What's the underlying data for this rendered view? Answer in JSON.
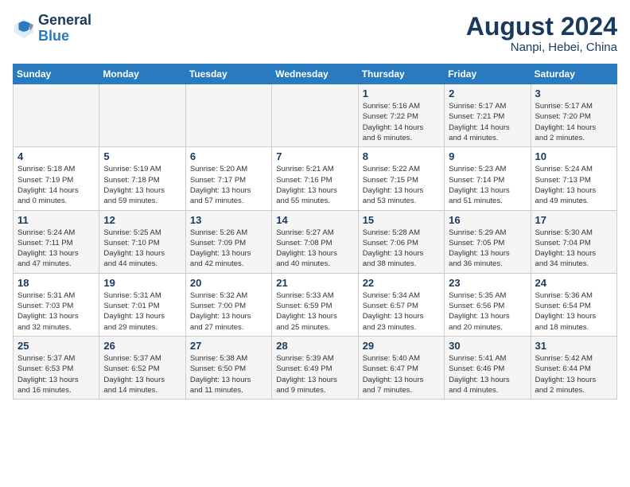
{
  "header": {
    "logo_line1": "General",
    "logo_line2": "Blue",
    "month_title": "August 2024",
    "subtitle": "Nanpi, Hebei, China"
  },
  "calendar": {
    "days_of_week": [
      "Sunday",
      "Monday",
      "Tuesday",
      "Wednesday",
      "Thursday",
      "Friday",
      "Saturday"
    ],
    "weeks": [
      [
        {
          "day": "",
          "info": ""
        },
        {
          "day": "",
          "info": ""
        },
        {
          "day": "",
          "info": ""
        },
        {
          "day": "",
          "info": ""
        },
        {
          "day": "1",
          "info": "Sunrise: 5:16 AM\nSunset: 7:22 PM\nDaylight: 14 hours\nand 6 minutes."
        },
        {
          "day": "2",
          "info": "Sunrise: 5:17 AM\nSunset: 7:21 PM\nDaylight: 14 hours\nand 4 minutes."
        },
        {
          "day": "3",
          "info": "Sunrise: 5:17 AM\nSunset: 7:20 PM\nDaylight: 14 hours\nand 2 minutes."
        }
      ],
      [
        {
          "day": "4",
          "info": "Sunrise: 5:18 AM\nSunset: 7:19 PM\nDaylight: 14 hours\nand 0 minutes."
        },
        {
          "day": "5",
          "info": "Sunrise: 5:19 AM\nSunset: 7:18 PM\nDaylight: 13 hours\nand 59 minutes."
        },
        {
          "day": "6",
          "info": "Sunrise: 5:20 AM\nSunset: 7:17 PM\nDaylight: 13 hours\nand 57 minutes."
        },
        {
          "day": "7",
          "info": "Sunrise: 5:21 AM\nSunset: 7:16 PM\nDaylight: 13 hours\nand 55 minutes."
        },
        {
          "day": "8",
          "info": "Sunrise: 5:22 AM\nSunset: 7:15 PM\nDaylight: 13 hours\nand 53 minutes."
        },
        {
          "day": "9",
          "info": "Sunrise: 5:23 AM\nSunset: 7:14 PM\nDaylight: 13 hours\nand 51 minutes."
        },
        {
          "day": "10",
          "info": "Sunrise: 5:24 AM\nSunset: 7:13 PM\nDaylight: 13 hours\nand 49 minutes."
        }
      ],
      [
        {
          "day": "11",
          "info": "Sunrise: 5:24 AM\nSunset: 7:11 PM\nDaylight: 13 hours\nand 47 minutes."
        },
        {
          "day": "12",
          "info": "Sunrise: 5:25 AM\nSunset: 7:10 PM\nDaylight: 13 hours\nand 44 minutes."
        },
        {
          "day": "13",
          "info": "Sunrise: 5:26 AM\nSunset: 7:09 PM\nDaylight: 13 hours\nand 42 minutes."
        },
        {
          "day": "14",
          "info": "Sunrise: 5:27 AM\nSunset: 7:08 PM\nDaylight: 13 hours\nand 40 minutes."
        },
        {
          "day": "15",
          "info": "Sunrise: 5:28 AM\nSunset: 7:06 PM\nDaylight: 13 hours\nand 38 minutes."
        },
        {
          "day": "16",
          "info": "Sunrise: 5:29 AM\nSunset: 7:05 PM\nDaylight: 13 hours\nand 36 minutes."
        },
        {
          "day": "17",
          "info": "Sunrise: 5:30 AM\nSunset: 7:04 PM\nDaylight: 13 hours\nand 34 minutes."
        }
      ],
      [
        {
          "day": "18",
          "info": "Sunrise: 5:31 AM\nSunset: 7:03 PM\nDaylight: 13 hours\nand 32 minutes."
        },
        {
          "day": "19",
          "info": "Sunrise: 5:31 AM\nSunset: 7:01 PM\nDaylight: 13 hours\nand 29 minutes."
        },
        {
          "day": "20",
          "info": "Sunrise: 5:32 AM\nSunset: 7:00 PM\nDaylight: 13 hours\nand 27 minutes."
        },
        {
          "day": "21",
          "info": "Sunrise: 5:33 AM\nSunset: 6:59 PM\nDaylight: 13 hours\nand 25 minutes."
        },
        {
          "day": "22",
          "info": "Sunrise: 5:34 AM\nSunset: 6:57 PM\nDaylight: 13 hours\nand 23 minutes."
        },
        {
          "day": "23",
          "info": "Sunrise: 5:35 AM\nSunset: 6:56 PM\nDaylight: 13 hours\nand 20 minutes."
        },
        {
          "day": "24",
          "info": "Sunrise: 5:36 AM\nSunset: 6:54 PM\nDaylight: 13 hours\nand 18 minutes."
        }
      ],
      [
        {
          "day": "25",
          "info": "Sunrise: 5:37 AM\nSunset: 6:53 PM\nDaylight: 13 hours\nand 16 minutes."
        },
        {
          "day": "26",
          "info": "Sunrise: 5:37 AM\nSunset: 6:52 PM\nDaylight: 13 hours\nand 14 minutes."
        },
        {
          "day": "27",
          "info": "Sunrise: 5:38 AM\nSunset: 6:50 PM\nDaylight: 13 hours\nand 11 minutes."
        },
        {
          "day": "28",
          "info": "Sunrise: 5:39 AM\nSunset: 6:49 PM\nDaylight: 13 hours\nand 9 minutes."
        },
        {
          "day": "29",
          "info": "Sunrise: 5:40 AM\nSunset: 6:47 PM\nDaylight: 13 hours\nand 7 minutes."
        },
        {
          "day": "30",
          "info": "Sunrise: 5:41 AM\nSunset: 6:46 PM\nDaylight: 13 hours\nand 4 minutes."
        },
        {
          "day": "31",
          "info": "Sunrise: 5:42 AM\nSunset: 6:44 PM\nDaylight: 13 hours\nand 2 minutes."
        }
      ]
    ]
  }
}
